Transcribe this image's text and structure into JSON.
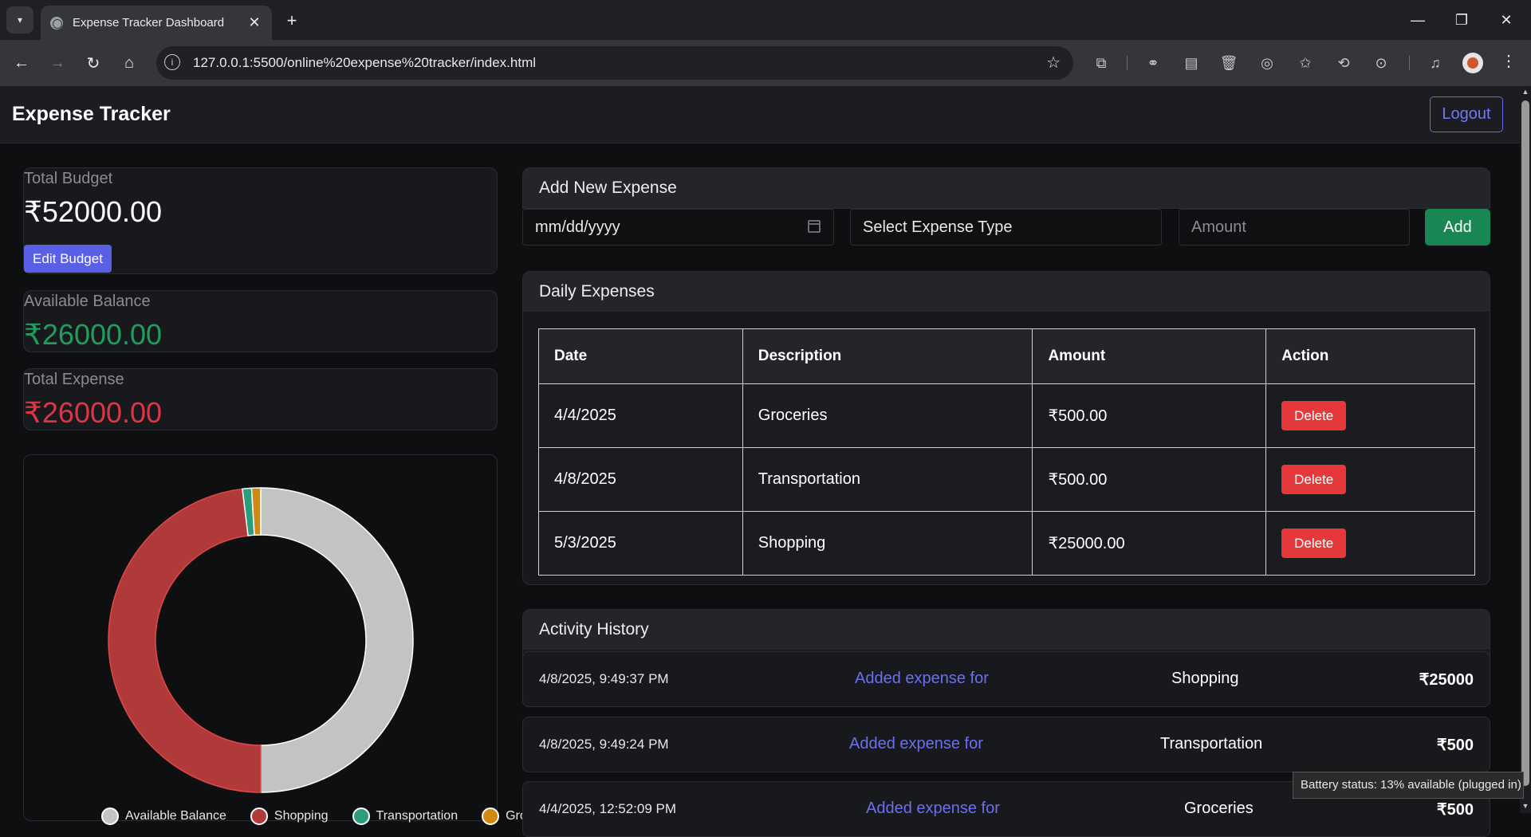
{
  "browser": {
    "tab_title": "Expense Tracker Dashboard",
    "url": "127.0.0.1:5500/online%20expense%20tracker/index.html"
  },
  "app": {
    "title": "Expense Tracker",
    "logout_label": "Logout"
  },
  "stats": {
    "budget_label": "Total Budget",
    "budget_value": "₹52000.00",
    "edit_budget_label": "Edit Budget",
    "balance_label": "Available Balance",
    "balance_value": "₹26000.00",
    "expense_label": "Total Expense",
    "expense_value": "₹26000.00"
  },
  "add_expense": {
    "title": "Add New Expense",
    "date_placeholder": "mm/dd/yyyy",
    "type_placeholder": "Select Expense Type",
    "amount_placeholder": "Amount",
    "add_label": "Add"
  },
  "daily_expenses": {
    "title": "Daily Expenses",
    "columns": [
      "Date",
      "Description",
      "Amount",
      "Action"
    ],
    "rows": [
      {
        "date": "4/4/2025",
        "description": "Groceries",
        "amount": "₹500.00",
        "action": "Delete"
      },
      {
        "date": "4/8/2025",
        "description": "Transportation",
        "amount": "₹500.00",
        "action": "Delete"
      },
      {
        "date": "5/3/2025",
        "description": "Shopping",
        "amount": "₹25000.00",
        "action": "Delete"
      }
    ]
  },
  "activity": {
    "title": "Activity History",
    "items": [
      {
        "time": "4/8/2025, 9:49:37 PM",
        "action": "Added expense for",
        "category": "Shopping",
        "amount": "₹25000"
      },
      {
        "time": "4/8/2025, 9:49:24 PM",
        "action": "Added expense for",
        "category": "Transportation",
        "amount": "₹500"
      },
      {
        "time": "4/4/2025, 12:52:09 PM",
        "action": "Added expense for",
        "category": "Groceries",
        "amount": "₹500"
      }
    ]
  },
  "chart_data": {
    "type": "pie",
    "variant": "doughnut",
    "categories": [
      "Available Balance",
      "Shopping",
      "Transportation",
      "Groceries"
    ],
    "values": [
      26000,
      25000,
      500,
      500
    ],
    "colors": [
      "#c2c4c2",
      "#b03a3a",
      "#2a9d7c",
      "#d08a12"
    ]
  },
  "tooltip": "Battery status: 13% available (plugged in)"
}
